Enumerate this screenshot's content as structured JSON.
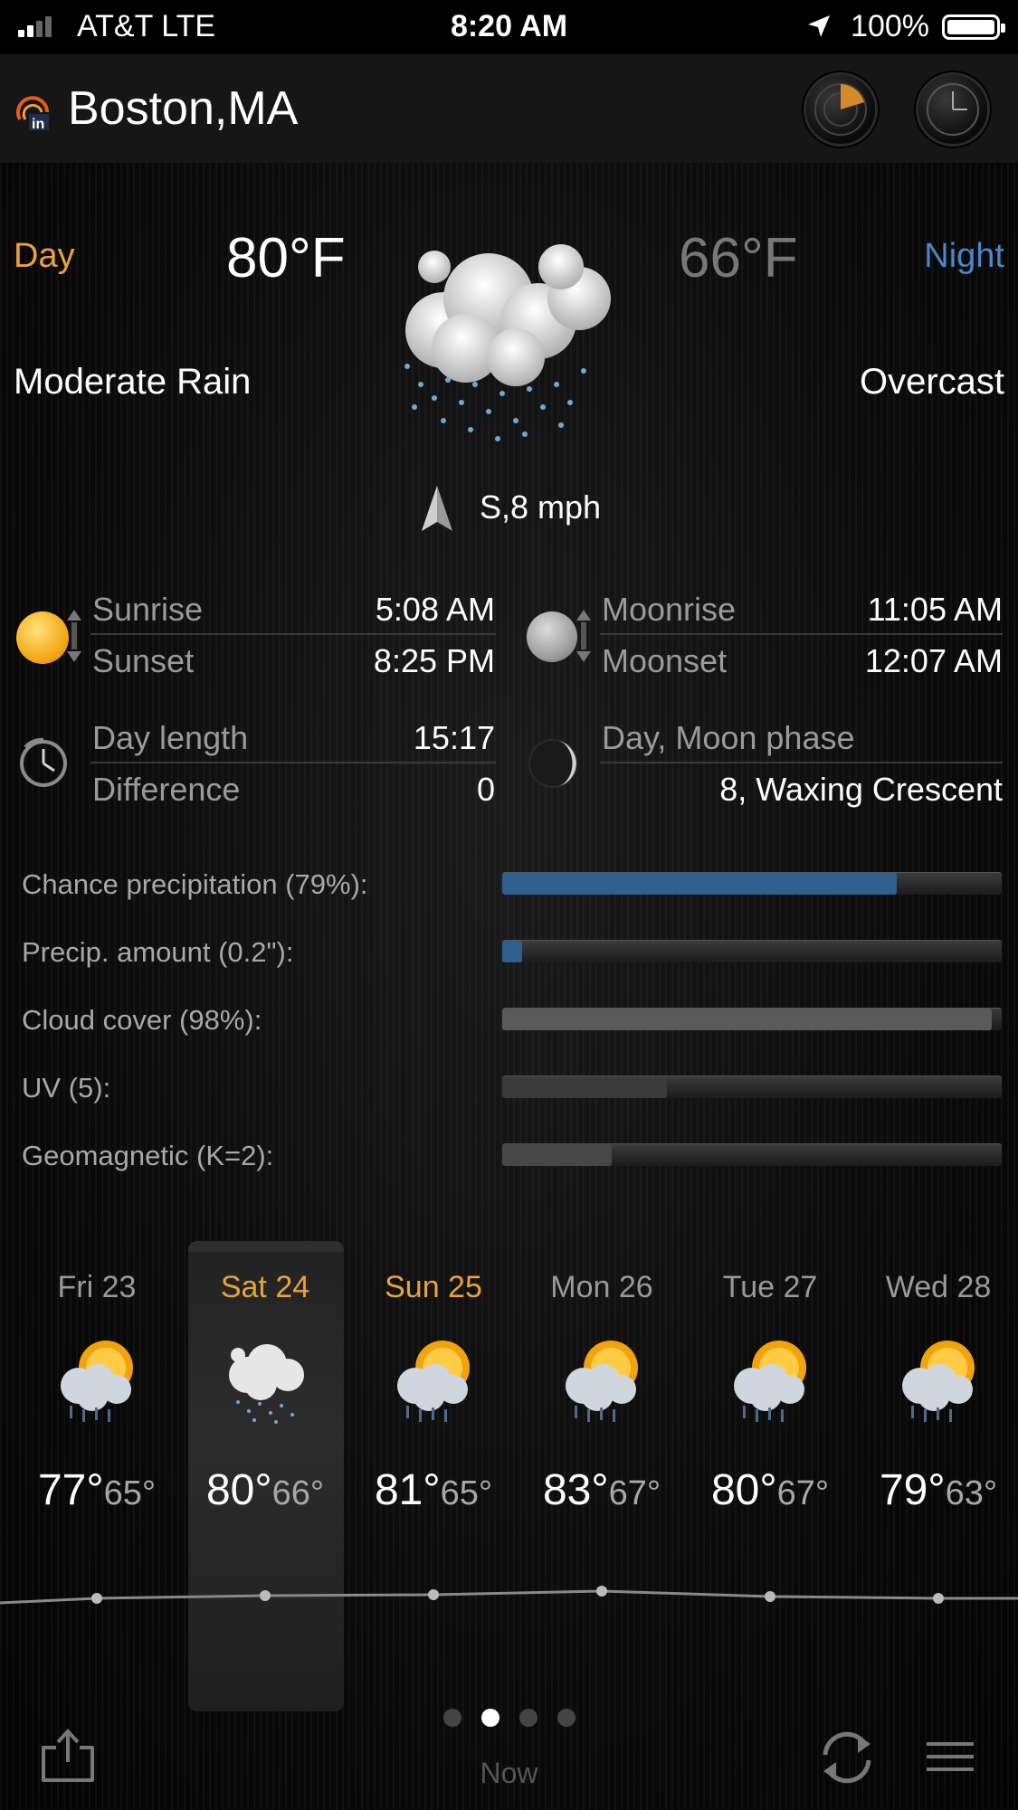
{
  "status_bar": {
    "carrier": "AT&T   LTE",
    "time": "8:20 AM",
    "battery": "100%"
  },
  "header": {
    "city": "Boston,MA"
  },
  "today": {
    "day_label": "Day",
    "night_label": "Night",
    "day_temp": "80°F",
    "night_temp": "66°F",
    "day_condition": "Moderate Rain",
    "night_condition": "Overcast",
    "wind": "S,8 mph"
  },
  "sun": {
    "sunrise_label": "Sunrise",
    "sunrise": "5:08 AM",
    "sunset_label": "Sunset",
    "sunset": "8:25 PM"
  },
  "moon": {
    "moonrise_label": "Moonrise",
    "moonrise": "11:05 AM",
    "moonset_label": "Moonset",
    "moonset": "12:07 AM"
  },
  "day_length": {
    "label": "Day length",
    "value": "15:17",
    "diff_label": "Difference",
    "diff_value": "0"
  },
  "moon_phase": {
    "label": "Day, Moon phase",
    "value": "8, Waxing Crescent"
  },
  "metrics": [
    {
      "label": "Chance precipitation (79%):",
      "fraction": 0.79,
      "color": "#2f5f8f"
    },
    {
      "label": "Precip. amount (0.2\"):",
      "fraction": 0.04,
      "color": "#2f5f8f"
    },
    {
      "label": "Cloud cover (98%):",
      "fraction": 0.98,
      "color": "#5a5a5a"
    },
    {
      "label": "UV (5):",
      "fraction": 0.33,
      "color": "#3a3a3a"
    },
    {
      "label": "Geomagnetic (K=2):",
      "fraction": 0.22,
      "color": "#474747"
    }
  ],
  "forecast": [
    {
      "day": "Fri 23",
      "hi": "77°",
      "lo": "65°",
      "icon": "partly-sunny-rain-icon",
      "highlight": false
    },
    {
      "day": "Sat 24",
      "hi": "80°",
      "lo": "66°",
      "icon": "rain-cloud-icon",
      "highlight": true
    },
    {
      "day": "Sun 25",
      "hi": "81°",
      "lo": "65°",
      "icon": "partly-sunny-rain-icon",
      "highlight": true
    },
    {
      "day": "Mon 26",
      "hi": "83°",
      "lo": "67°",
      "icon": "partly-sunny-rain-icon",
      "highlight": false
    },
    {
      "day": "Tue 27",
      "hi": "80°",
      "lo": "67°",
      "icon": "partly-sunny-rain-icon",
      "highlight": false
    },
    {
      "day": "Wed 28",
      "hi": "79°",
      "lo": "63°",
      "icon": "partly-sunny-rain-icon",
      "highlight": false
    }
  ],
  "pager": {
    "pages": 4,
    "active": 1
  },
  "bottom": {
    "now_label": "Now"
  }
}
